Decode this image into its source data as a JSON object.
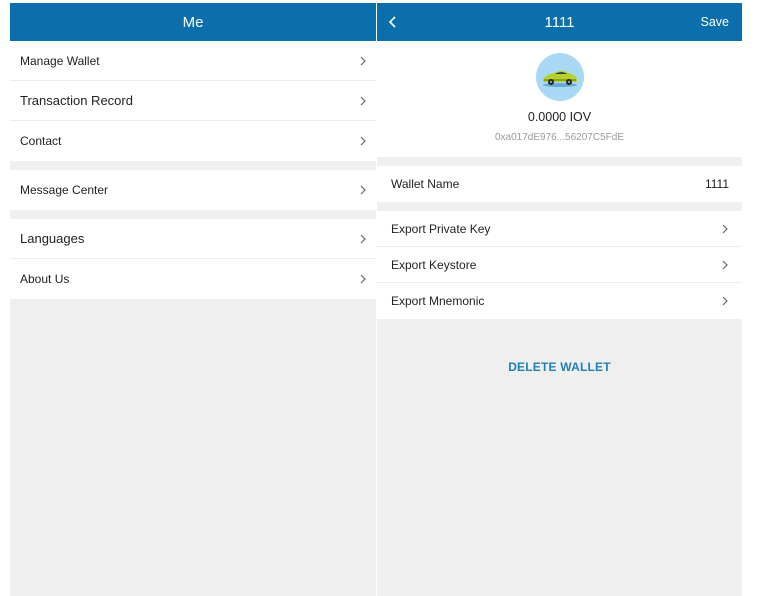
{
  "me": {
    "title": "Me",
    "group1": [
      {
        "label": "Manage Wallet"
      },
      {
        "label": "Transaction Record"
      },
      {
        "label": "Contact"
      }
    ],
    "group2": [
      {
        "label": "Message Center"
      }
    ],
    "group3": [
      {
        "label": "Languages"
      },
      {
        "label": "About Us"
      }
    ]
  },
  "wallet": {
    "title": "1111",
    "save_label": "Save",
    "avatar_icon": "car-icon",
    "balance": "0.0000 IOV",
    "address": "0xa017dE976...56207C5FdE",
    "name_label": "Wallet Name",
    "name_value": "1111",
    "exports": [
      {
        "label": "Export Private Key"
      },
      {
        "label": "Export Keystore"
      },
      {
        "label": "Export Mnemonic"
      }
    ],
    "delete_label": "DELETE WALLET"
  },
  "colors": {
    "header": "#0a6fab",
    "link": "#2180b6",
    "background": "#efefef"
  }
}
